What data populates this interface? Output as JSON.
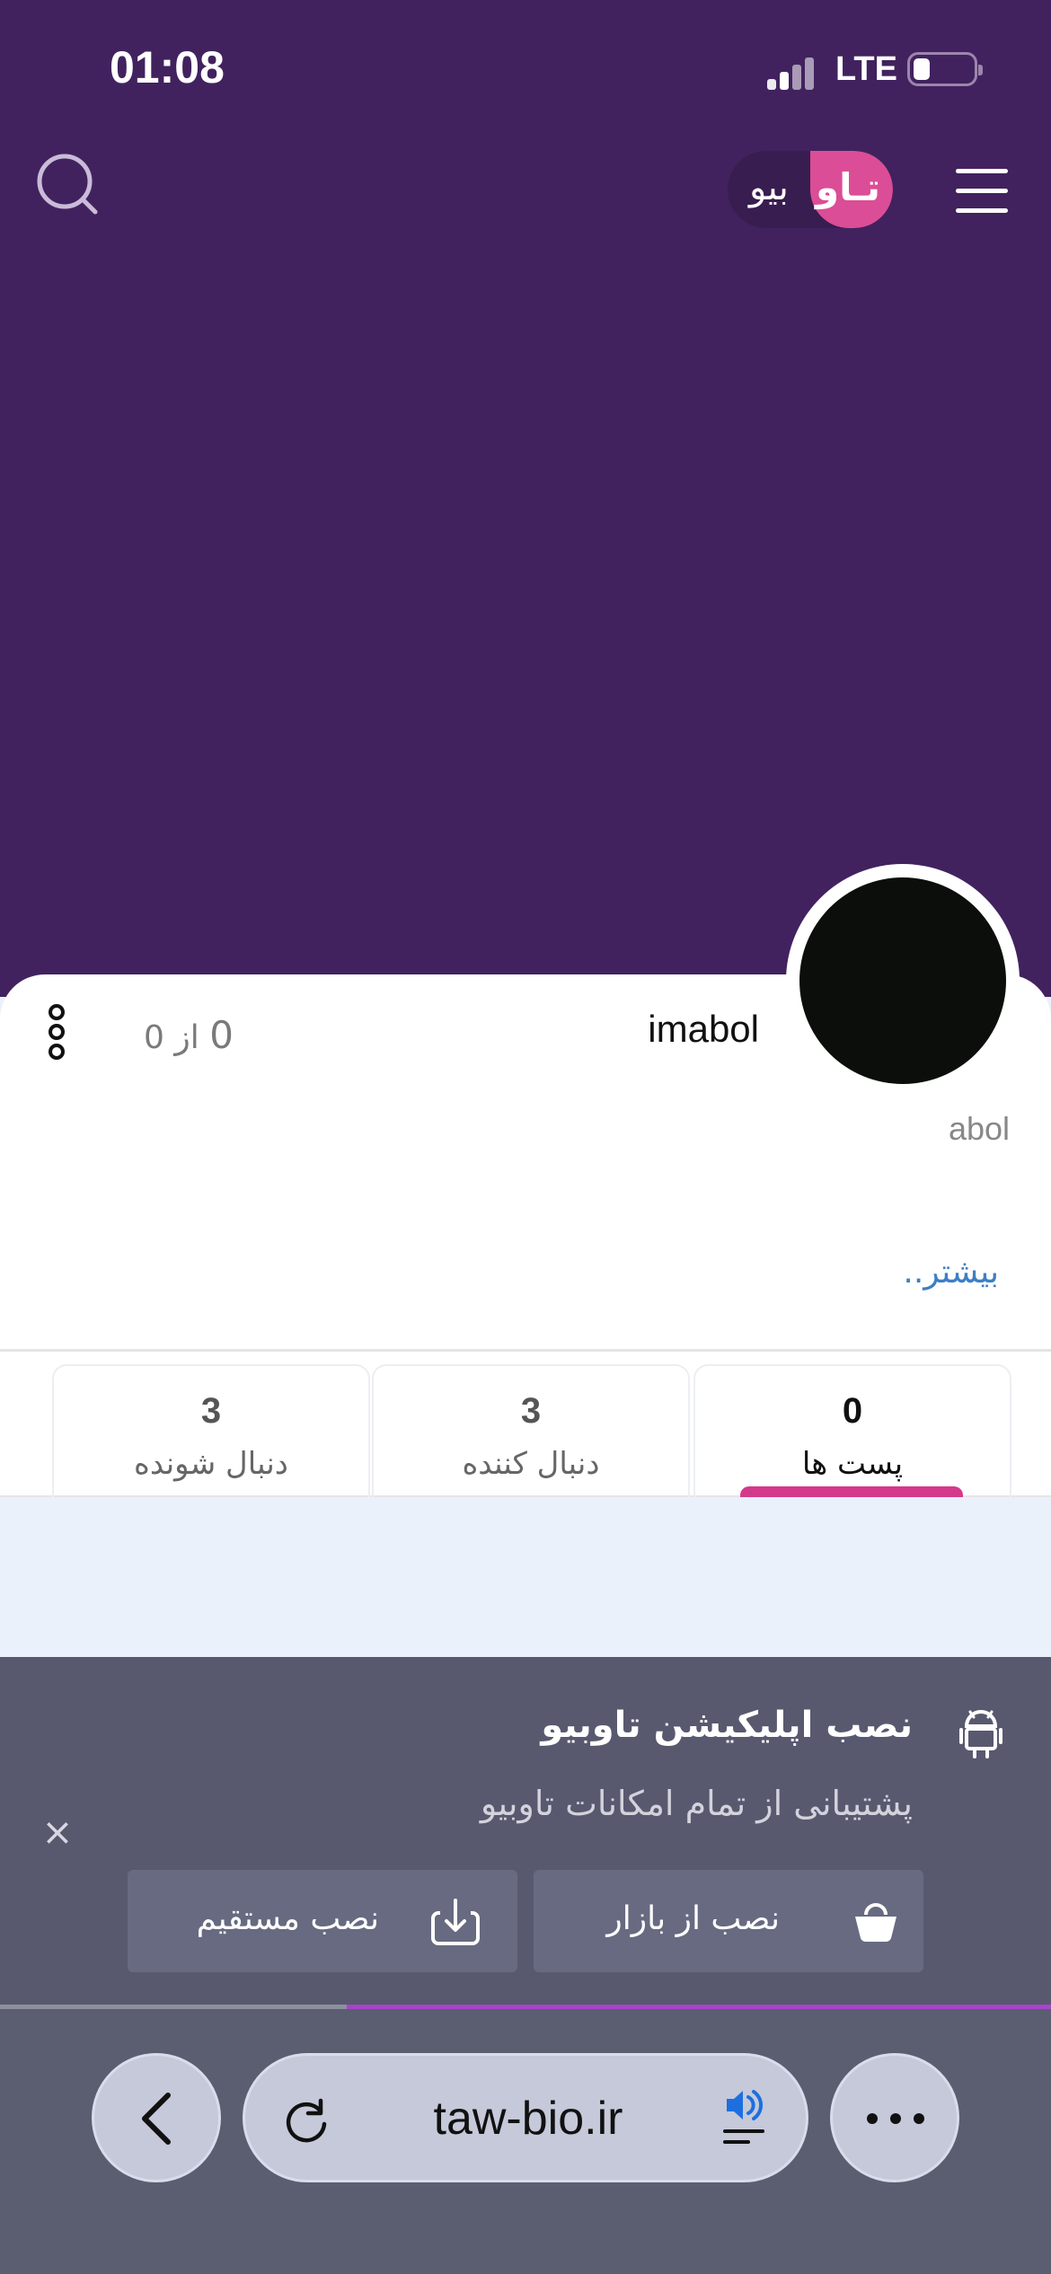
{
  "status_bar": {
    "time": "01:08",
    "network": "LTE",
    "battery_level": 0.2
  },
  "header": {
    "logo_part1": "تـاو",
    "logo_part2": "بیو",
    "search_icon": "search-icon",
    "menu_icon": "hamburger-menu-icon"
  },
  "profile": {
    "username": "imabol",
    "counter_value": "0",
    "counter_total": "از 0",
    "bio": "abol",
    "more_link": "بیشتر..",
    "options_icon": "vertical-dots-icon"
  },
  "stats": [
    {
      "value": "0",
      "label": "پست ها",
      "active": true
    },
    {
      "value": "3",
      "label": "دنبال کننده",
      "active": false
    },
    {
      "value": "3",
      "label": "دنبال شونده",
      "active": false
    }
  ],
  "install_banner": {
    "title": "نصب اپلیکیشن تاوبیو",
    "subtitle": "پشتیبانی از تمام امکانات تاوبیو",
    "bazaar_button": "نصب از بازار",
    "direct_button": "نصب مستقیم",
    "close_symbol": "×",
    "icons": [
      "android-icon",
      "bag-icon",
      "download-icon",
      "close-icon"
    ]
  },
  "browser": {
    "url": "taw-bio.ir",
    "load_progress": 0.67,
    "icons": [
      "back-arrow-icon",
      "reload-icon",
      "speaker-icon",
      "more-dots-icon"
    ]
  },
  "colors": {
    "header_bg": "#41225e",
    "accent_pink": "#db4d96",
    "tab_indicator": "#d43a8a",
    "banner_bg": "#58596f",
    "link_blue": "#3d7fc4",
    "progress": "#a545c9"
  }
}
